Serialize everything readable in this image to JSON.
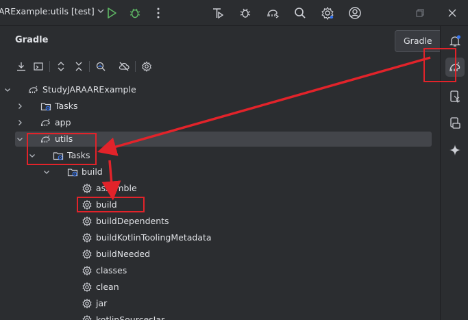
{
  "titlebar": {
    "run_config": "ARExample:utils [test]",
    "icons": [
      "run-icon",
      "debug-icon",
      "more-vert-icon",
      "coverage-icon",
      "bug-icon",
      "gradle-sync-icon",
      "search-icon",
      "settings-icon",
      "account-icon",
      "restore-window-icon",
      "close-window-icon"
    ]
  },
  "panel": {
    "title": "Gradle",
    "toolbar_icons": [
      "download-icon",
      "run-tasks-icon",
      "expand-all-icon",
      "collapse-all-icon",
      "analyze-icon",
      "offline-icon",
      "gradle-settings-icon"
    ]
  },
  "tooltip": {
    "text": "Gradle"
  },
  "tree": [
    {
      "label": "StudyJARAARExample",
      "icon": "gradle-elephant-icon",
      "arrow": "down",
      "depth": 0
    },
    {
      "label": "Tasks",
      "icon": "tasks-folder-icon",
      "arrow": "right",
      "depth": 1
    },
    {
      "label": "app",
      "icon": "gradle-elephant-icon",
      "arrow": "right",
      "depth": 1
    },
    {
      "label": "utils",
      "icon": "gradle-elephant-icon",
      "arrow": "down",
      "depth": 1,
      "selected": true
    },
    {
      "label": "Tasks",
      "icon": "tasks-folder-icon",
      "arrow": "down",
      "depth": 2
    },
    {
      "label": "build",
      "icon": "tasks-folder-icon",
      "arrow": "down",
      "depth": 3
    },
    {
      "label": "assemble",
      "icon": "task-gear-icon",
      "depth": 4
    },
    {
      "label": "build",
      "icon": "task-gear-icon",
      "depth": 4
    },
    {
      "label": "buildDependents",
      "icon": "task-gear-icon",
      "depth": 4
    },
    {
      "label": "buildKotlinToolingMetadata",
      "icon": "task-gear-icon",
      "depth": 4
    },
    {
      "label": "buildNeeded",
      "icon": "task-gear-icon",
      "depth": 4
    },
    {
      "label": "classes",
      "icon": "task-gear-icon",
      "depth": 4
    },
    {
      "label": "clean",
      "icon": "task-gear-icon",
      "depth": 4
    },
    {
      "label": "jar",
      "icon": "task-gear-icon",
      "depth": 4
    },
    {
      "label": "kotlinSourcesJar",
      "icon": "task-gear-icon",
      "depth": 4
    }
  ],
  "rightstrip": {
    "icons": [
      "notifications-icon",
      "gradle-icon",
      "device-manager-icon",
      "running-devices-icon",
      "gemini-icon"
    ],
    "active": "gradle-icon"
  },
  "colors": {
    "background": "#2b2d30",
    "selection": "#43454a",
    "annotation": "#e2232a",
    "run_green": "#5fb865",
    "notification_dot": "#3574f0"
  }
}
